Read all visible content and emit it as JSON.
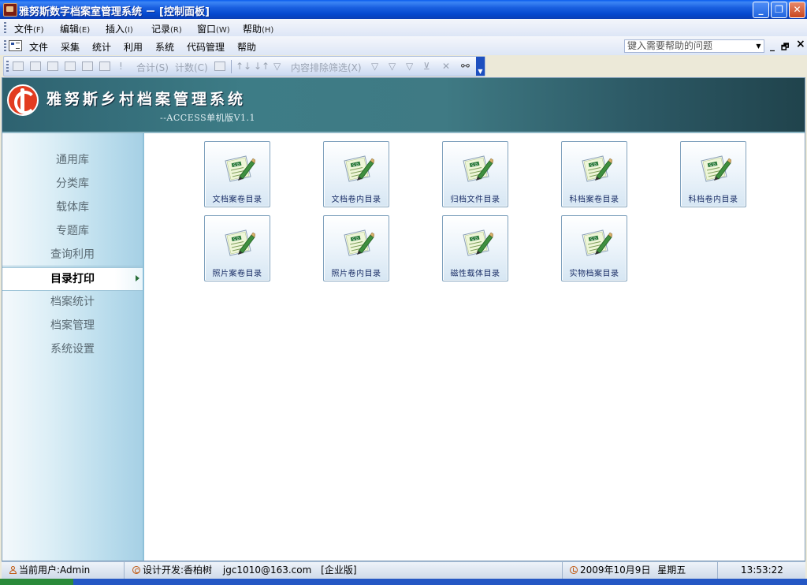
{
  "window": {
    "title": "雅努斯数字档案室管理系统 － [控制面板]",
    "buttons": {
      "minimize": "_",
      "restore": "❐",
      "close": "✕"
    }
  },
  "menubar": [
    {
      "label": "文件",
      "accel": "(F)"
    },
    {
      "label": "编辑",
      "accel": "(E)"
    },
    {
      "label": "插入",
      "accel": "(I)"
    },
    {
      "label": "记录",
      "accel": "(R)"
    },
    {
      "label": "窗口",
      "accel": "(W)"
    },
    {
      "label": "帮助",
      "accel": "(H)"
    }
  ],
  "menubar2": [
    "文件",
    "采集",
    "统计",
    "利用",
    "系统",
    "代码管理",
    "帮助"
  ],
  "help_box": {
    "placeholder": "键入需要帮助的问题",
    "dropdown": "▼"
  },
  "mdi_controls": {
    "minimize": "_",
    "restore": "🗗",
    "close": "×"
  },
  "toolbar": {
    "total_label": "合计(S)",
    "count_label": "计数(C)",
    "exclude_filter_label": "内容排除筛选(X)"
  },
  "banner": {
    "title": "雅努斯乡村档案管理系统",
    "version": "--ACCESS单机版V1.1"
  },
  "sidebar": {
    "items": [
      "通用库",
      "分类库",
      "载体库",
      "专题库",
      "查询利用",
      "目录打印",
      "档案统计",
      "档案管理",
      "系统设置"
    ],
    "active_index": 5
  },
  "tiles": [
    "文档案卷目录",
    "文档卷内目录",
    "归档文件目录",
    "科档案卷目录",
    "科档卷内目录",
    "照片案卷目录",
    "照片卷内目录",
    "磁性载体目录",
    "实物档案目录"
  ],
  "statusbar": {
    "user": "当前用户:Admin",
    "developer": "设计开发:香柏树",
    "email": "jgc1010@163.com",
    "edition": "[企业版]",
    "date": "2009年10月9日",
    "weekday": "星期五",
    "time": "13:53:22"
  },
  "colors": {
    "titlebar": "#0A5CEE",
    "banner": "#3d7c86",
    "sidebar": "#b9dcec",
    "tile_border": "#7fa1bd",
    "tile_label": "#1b2f67"
  }
}
